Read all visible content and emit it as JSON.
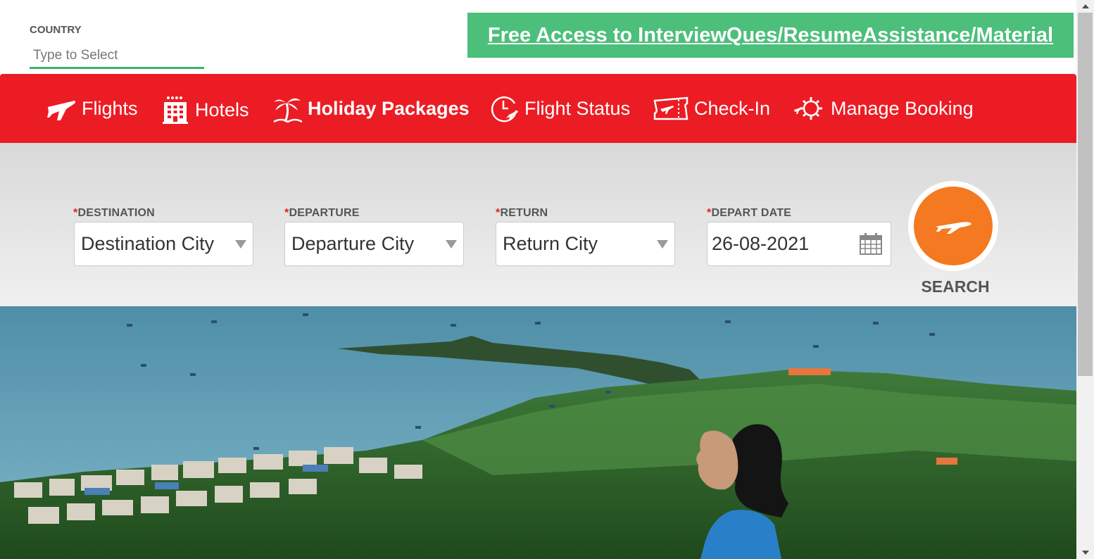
{
  "top": {
    "country_label": "COUNTRY",
    "country_placeholder": "Type to Select",
    "promo_link": "Free Access to InterviewQues/ResumeAssistance/Material"
  },
  "nav": {
    "items": [
      {
        "label": "Flights",
        "icon": "plane-icon"
      },
      {
        "label": "Hotels",
        "icon": "hotel-building-icon"
      },
      {
        "label": "Holiday Packages",
        "icon": "palm-tree-icon",
        "active": true
      },
      {
        "label": "Flight Status",
        "icon": "clock-plane-icon"
      },
      {
        "label": "Check-In",
        "icon": "ticket-icon"
      },
      {
        "label": "Manage Booking",
        "icon": "gear-plane-icon"
      }
    ]
  },
  "search": {
    "required_mark": "*",
    "destination_label": "DESTINATION",
    "destination_value": "Destination City",
    "departure_label": "DEPARTURE",
    "departure_value": "Departure City",
    "return_label": "RETURN",
    "return_value": "Return City",
    "depart_date_label": "DEPART DATE",
    "depart_date_value": "26-08-2021",
    "search_label": "SEARCH"
  },
  "colors": {
    "nav_bg": "#ec1c24",
    "promo_bg": "#4cbf7a",
    "search_button": "#f47920",
    "country_underline": "#3cb371"
  }
}
